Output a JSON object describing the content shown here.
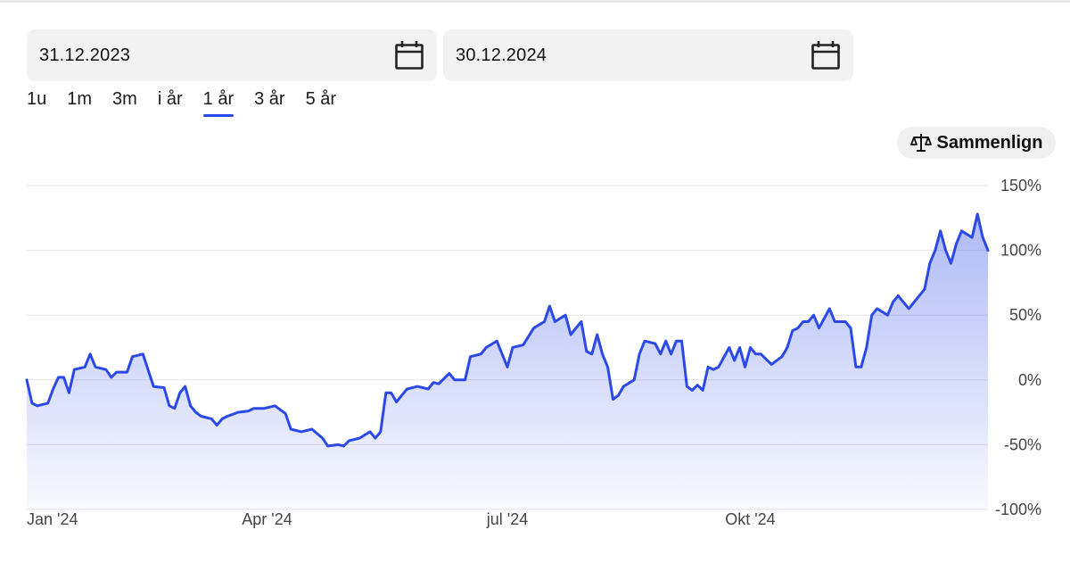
{
  "date_range": {
    "from": {
      "value": "31.12.2023",
      "icon": "calendar-icon"
    },
    "to": {
      "value": "30.12.2024",
      "icon": "calendar-icon"
    }
  },
  "range_tabs": [
    {
      "label": "1u",
      "active": false
    },
    {
      "label": "1m",
      "active": false
    },
    {
      "label": "3m",
      "active": false
    },
    {
      "label": "i år",
      "active": false
    },
    {
      "label": "1 år",
      "active": true
    },
    {
      "label": "3 år",
      "active": false
    },
    {
      "label": "5 år",
      "active": false
    }
  ],
  "compare_button": {
    "label": "Sammenlign",
    "icon": "scale-icon"
  },
  "colors": {
    "line": "#2b49e8",
    "active_tab": "#2b49e8",
    "grid": "#e4e4e4"
  },
  "chart_data": {
    "type": "area",
    "x_tick_labels": [
      "Jan '24",
      "Apr '24",
      "jul '24",
      "Okt '24"
    ],
    "y_tick_labels": [
      "150%",
      "100%",
      "50%",
      "0%",
      "-50%",
      "-100%"
    ],
    "ylim": [
      -100,
      150
    ],
    "grid": true,
    "series": [
      {
        "unit": "%",
        "points": [
          [
            "2024-01-01",
            0
          ],
          [
            "2024-01-03",
            -18
          ],
          [
            "2024-01-05",
            -20
          ],
          [
            "2024-01-09",
            -18
          ],
          [
            "2024-01-11",
            -7
          ],
          [
            "2024-01-13",
            2
          ],
          [
            "2024-01-15",
            2
          ],
          [
            "2024-01-17",
            -10
          ],
          [
            "2024-01-19",
            8
          ],
          [
            "2024-01-23",
            10
          ],
          [
            "2024-01-25",
            20
          ],
          [
            "2024-01-27",
            10
          ],
          [
            "2024-01-31",
            8
          ],
          [
            "2024-02-02",
            2
          ],
          [
            "2024-02-04",
            6
          ],
          [
            "2024-02-08",
            6
          ],
          [
            "2024-02-10",
            18
          ],
          [
            "2024-02-14",
            20
          ],
          [
            "2024-02-18",
            -5
          ],
          [
            "2024-02-22",
            -6
          ],
          [
            "2024-02-24",
            -20
          ],
          [
            "2024-02-26",
            -22
          ],
          [
            "2024-02-28",
            -10
          ],
          [
            "2024-03-01",
            -5
          ],
          [
            "2024-03-03",
            -20
          ],
          [
            "2024-03-05",
            -25
          ],
          [
            "2024-03-07",
            -28
          ],
          [
            "2024-03-11",
            -30
          ],
          [
            "2024-03-13",
            -35
          ],
          [
            "2024-03-15",
            -30
          ],
          [
            "2024-03-17",
            -28
          ],
          [
            "2024-03-21",
            -25
          ],
          [
            "2024-03-25",
            -24
          ],
          [
            "2024-03-27",
            -22
          ],
          [
            "2024-03-31",
            -22
          ],
          [
            "2024-04-04",
            -20
          ],
          [
            "2024-04-08",
            -26
          ],
          [
            "2024-04-10",
            -38
          ],
          [
            "2024-04-14",
            -40
          ],
          [
            "2024-04-18",
            -38
          ],
          [
            "2024-04-22",
            -45
          ],
          [
            "2024-04-24",
            -51
          ],
          [
            "2024-04-28",
            -50
          ],
          [
            "2024-04-30",
            -51
          ],
          [
            "2024-05-02",
            -47
          ],
          [
            "2024-05-06",
            -45
          ],
          [
            "2024-05-10",
            -40
          ],
          [
            "2024-05-12",
            -45
          ],
          [
            "2024-05-14",
            -40
          ],
          [
            "2024-05-16",
            -10
          ],
          [
            "2024-05-18",
            -10
          ],
          [
            "2024-05-20",
            -17
          ],
          [
            "2024-05-22",
            -12
          ],
          [
            "2024-05-24",
            -7
          ],
          [
            "2024-05-28",
            -5
          ],
          [
            "2024-06-01",
            -7
          ],
          [
            "2024-06-03",
            -2
          ],
          [
            "2024-06-05",
            -3
          ],
          [
            "2024-06-09",
            5
          ],
          [
            "2024-06-11",
            0
          ],
          [
            "2024-06-15",
            0
          ],
          [
            "2024-06-17",
            18
          ],
          [
            "2024-06-21",
            20
          ],
          [
            "2024-06-23",
            25
          ],
          [
            "2024-06-27",
            30
          ],
          [
            "2024-06-29",
            20
          ],
          [
            "2024-07-01",
            10
          ],
          [
            "2024-07-03",
            25
          ],
          [
            "2024-07-07",
            27
          ],
          [
            "2024-07-11",
            40
          ],
          [
            "2024-07-15",
            45
          ],
          [
            "2024-07-17",
            57
          ],
          [
            "2024-07-19",
            45
          ],
          [
            "2024-07-23",
            50
          ],
          [
            "2024-07-25",
            35
          ],
          [
            "2024-07-27",
            40
          ],
          [
            "2024-07-29",
            45
          ],
          [
            "2024-07-31",
            22
          ],
          [
            "2024-08-02",
            20
          ],
          [
            "2024-08-04",
            35
          ],
          [
            "2024-08-06",
            20
          ],
          [
            "2024-08-08",
            10
          ],
          [
            "2024-08-10",
            -15
          ],
          [
            "2024-08-12",
            -12
          ],
          [
            "2024-08-14",
            -5
          ],
          [
            "2024-08-18",
            0
          ],
          [
            "2024-08-20",
            20
          ],
          [
            "2024-08-22",
            30
          ],
          [
            "2024-08-26",
            28
          ],
          [
            "2024-08-28",
            20
          ],
          [
            "2024-08-30",
            30
          ],
          [
            "2024-09-01",
            20
          ],
          [
            "2024-09-03",
            30
          ],
          [
            "2024-09-05",
            30
          ],
          [
            "2024-09-07",
            -5
          ],
          [
            "2024-09-09",
            -8
          ],
          [
            "2024-09-11",
            -4
          ],
          [
            "2024-09-13",
            -8
          ],
          [
            "2024-09-15",
            10
          ],
          [
            "2024-09-17",
            8
          ],
          [
            "2024-09-19",
            10
          ],
          [
            "2024-09-23",
            25
          ],
          [
            "2024-09-25",
            15
          ],
          [
            "2024-09-27",
            25
          ],
          [
            "2024-09-29",
            10
          ],
          [
            "2024-10-01",
            25
          ],
          [
            "2024-10-03",
            20
          ],
          [
            "2024-10-05",
            20
          ],
          [
            "2024-10-09",
            12
          ],
          [
            "2024-10-13",
            18
          ],
          [
            "2024-10-15",
            25
          ],
          [
            "2024-10-17",
            38
          ],
          [
            "2024-10-19",
            40
          ],
          [
            "2024-10-21",
            45
          ],
          [
            "2024-10-23",
            45
          ],
          [
            "2024-10-25",
            50
          ],
          [
            "2024-10-27",
            40
          ],
          [
            "2024-10-31",
            55
          ],
          [
            "2024-11-02",
            45
          ],
          [
            "2024-11-04",
            45
          ],
          [
            "2024-11-06",
            45
          ],
          [
            "2024-11-08",
            40
          ],
          [
            "2024-11-10",
            10
          ],
          [
            "2024-11-12",
            10
          ],
          [
            "2024-11-14",
            25
          ],
          [
            "2024-11-16",
            50
          ],
          [
            "2024-11-18",
            55
          ],
          [
            "2024-11-22",
            50
          ],
          [
            "2024-11-24",
            60
          ],
          [
            "2024-11-26",
            65
          ],
          [
            "2024-11-28",
            60
          ],
          [
            "2024-11-30",
            55
          ],
          [
            "2024-12-02",
            60
          ],
          [
            "2024-12-06",
            70
          ],
          [
            "2024-12-08",
            90
          ],
          [
            "2024-12-10",
            100
          ],
          [
            "2024-12-12",
            115
          ],
          [
            "2024-12-14",
            100
          ],
          [
            "2024-12-16",
            90
          ],
          [
            "2024-12-18",
            105
          ],
          [
            "2024-12-20",
            115
          ],
          [
            "2024-12-24",
            110
          ],
          [
            "2024-12-26",
            128
          ],
          [
            "2024-12-28",
            110
          ],
          [
            "2024-12-30",
            100
          ]
        ]
      }
    ]
  }
}
